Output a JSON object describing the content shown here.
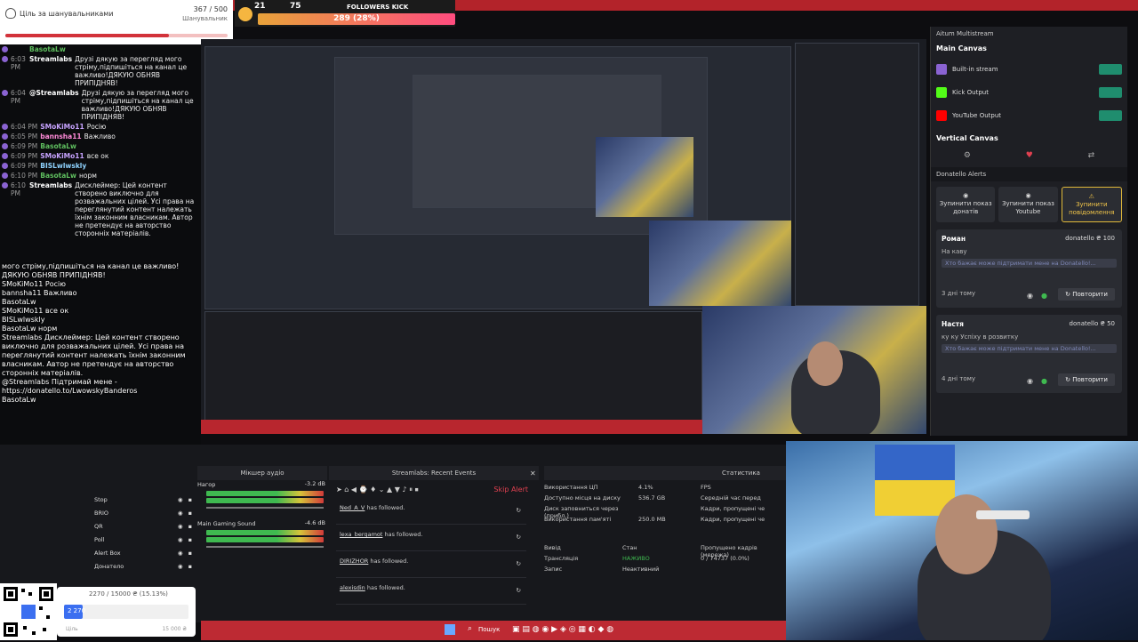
{
  "goal": {
    "title": "Ціль за шанувальниками",
    "value": "367 / 500",
    "sub": "Шанувальник",
    "progress": 0.734
  },
  "follow_widget": {
    "count1": "21",
    "count2": "75",
    "label": "FOLLOWERS KICK",
    "progress": "289 (28%)"
  },
  "chat": [
    {
      "time": "",
      "user": "BasotaLw",
      "msg": "",
      "color": "#5fbf5f"
    },
    {
      "time": "6:03 PM",
      "user": "Streamlabs",
      "msg": "Друзі дякую за перегляд мого стріму,підпишіться на канал це важливо!ДЯКУЮ ОБНЯВ ПРИПІДНЯВ!",
      "color": "#ffffff"
    },
    {
      "time": "6:04 PM",
      "user": "@Streamlabs",
      "msg": "Друзі дякую за перегляд мого стріму,підпишіться на канал це важливо!ДЯКУЮ ОБНЯВ ПРИПІДНЯВ!",
      "color": "#ffffff"
    },
    {
      "time": "6:04 PM",
      "user": "SMoKiMo11",
      "msg": "Росію",
      "color": "#c7a3ff"
    },
    {
      "time": "6:05 PM",
      "user": "bannsha11",
      "msg": "Важливо",
      "color": "#ff8ad8"
    },
    {
      "time": "6:09 PM",
      "user": "BasotaLw",
      "msg": "",
      "color": "#5fbf5f"
    },
    {
      "time": "6:09 PM",
      "user": "SMoKiMo11",
      "msg": "все ок",
      "color": "#c7a3ff"
    },
    {
      "time": "6:09 PM",
      "user": "BISLwlwskly",
      "msg": "",
      "color": "#8fd3ff"
    },
    {
      "time": "6:10 PM",
      "user": "BasotaLw",
      "msg": "норм",
      "color": "#5fbf5f"
    },
    {
      "time": "6:10 PM",
      "user": "Streamlabs",
      "msg": "Дисклеймер: Цей контент створено виключно для розважальних цілей. Усі права на переглянутий контент належать їхнім законним власникам. Автор не претендує на авторство сторонніх матеріалів.",
      "color": "#ffffff"
    }
  ],
  "overlay_chat": [
    "могo стріму,підпишіться на канал це важливо!",
    "ДЯКУЮ ОБНЯВ ПРИПІДНЯВ!",
    "SMoKiMo11 Росію",
    "bannsha11 Важливо",
    "BasotaLw",
    "SMoKiMo11 все ок",
    "BISLwlwskly",
    "BasotaLw норм",
    "Streamlabs Дисклеймер: Цей контент створено виключно для розважальних цілей. Усі права на переглянутий контент належать їхнім законним власникам. Автор не претендує на авторство сторонніх матеріалів.",
    "@Streamlabs Підтримай мене - https://donatello.to/LwowskyBanderos",
    "BasotaLw"
  ],
  "panel": {
    "title": "Aitum Multistream",
    "main_canvas": "Main Canvas",
    "outputs": [
      {
        "label": "Built-in stream",
        "color": "#8a63d2"
      },
      {
        "label": "Kick Output",
        "color": "#53fc18"
      },
      {
        "label": "YouTube Output",
        "color": "#ff0000"
      }
    ],
    "vertical_canvas": "Vertical Canvas",
    "alerts_title": "Donatello Alerts",
    "buttons": [
      {
        "label": "Зупинити показ донатів"
      },
      {
        "label": "Зупинити показ Youtube"
      },
      {
        "label": "Зупинити повідомлення"
      }
    ],
    "donations": [
      {
        "name": "Роман",
        "amount": "donatello ₴ 100",
        "message": "На каву",
        "link": "Хто бажає може підтримати мене на Donatello!...",
        "ago": "3 дні тому",
        "replay": "Повторити"
      },
      {
        "name": "Настя",
        "amount": "donatello ₴ 50",
        "message": "ку ку Успіху в розвитку",
        "link": "Хто бажає може підтримати мене на Donatello!...",
        "ago": "4 дні тому",
        "replay": "Повторити"
      }
    ]
  },
  "dock": {
    "mixer_title": "Мікшер аудіо",
    "events_title": "Streamlabs: Recent Events",
    "stats_title": "Статистика",
    "skip_alert": "Skip Alert",
    "sources": [
      "Stop",
      "BRIO",
      "QR",
      "Poll",
      "Alert Box",
      "Донатело"
    ],
    "mixer": [
      {
        "name": "Нагор",
        "db": "-3.2 dB"
      },
      {
        "name": "Main Gaming Sound",
        "db": "-4.6 dB"
      }
    ],
    "events": [
      {
        "user": "Ned_A_V",
        "text": "has followed."
      },
      {
        "user": "lexa_bergamot",
        "text": "has followed."
      },
      {
        "user": "DIRIZHOR",
        "text": "has followed."
      },
      {
        "user": "alexisdin",
        "text": "has followed."
      }
    ],
    "stats": [
      {
        "k": "Використання ЦП",
        "v": "4.1%",
        "k2": "FPS"
      },
      {
        "k": "Доступно місця на диску",
        "v": "536.7 GB",
        "k2": "Середній час перед"
      },
      {
        "k": "Диск заповниться через (прибл.)",
        "v": "",
        "k2": "Кадри, пропущені че"
      },
      {
        "k": "Використання пам'яті",
        "v": "250.0 MB",
        "k2": "Кадри, пропущені че"
      }
    ],
    "out_table": {
      "h": [
        "Вивід",
        "Стан",
        "Пропущено кадрів (мережа)"
      ],
      "rows": [
        [
          "Трансляція",
          "НАЖИВО",
          "0 / 74737 (0.0%)"
        ],
        [
          "Запис",
          "Неактивний",
          ""
        ]
      ]
    }
  },
  "donation_bar": {
    "text": "2270 / 15000 ₴ (15.13%)",
    "current": "2 270",
    "max": "15 000 ₴",
    "min": "Ціль",
    "progress": 0.1513
  },
  "taskbar": {
    "search": "Пошук"
  }
}
